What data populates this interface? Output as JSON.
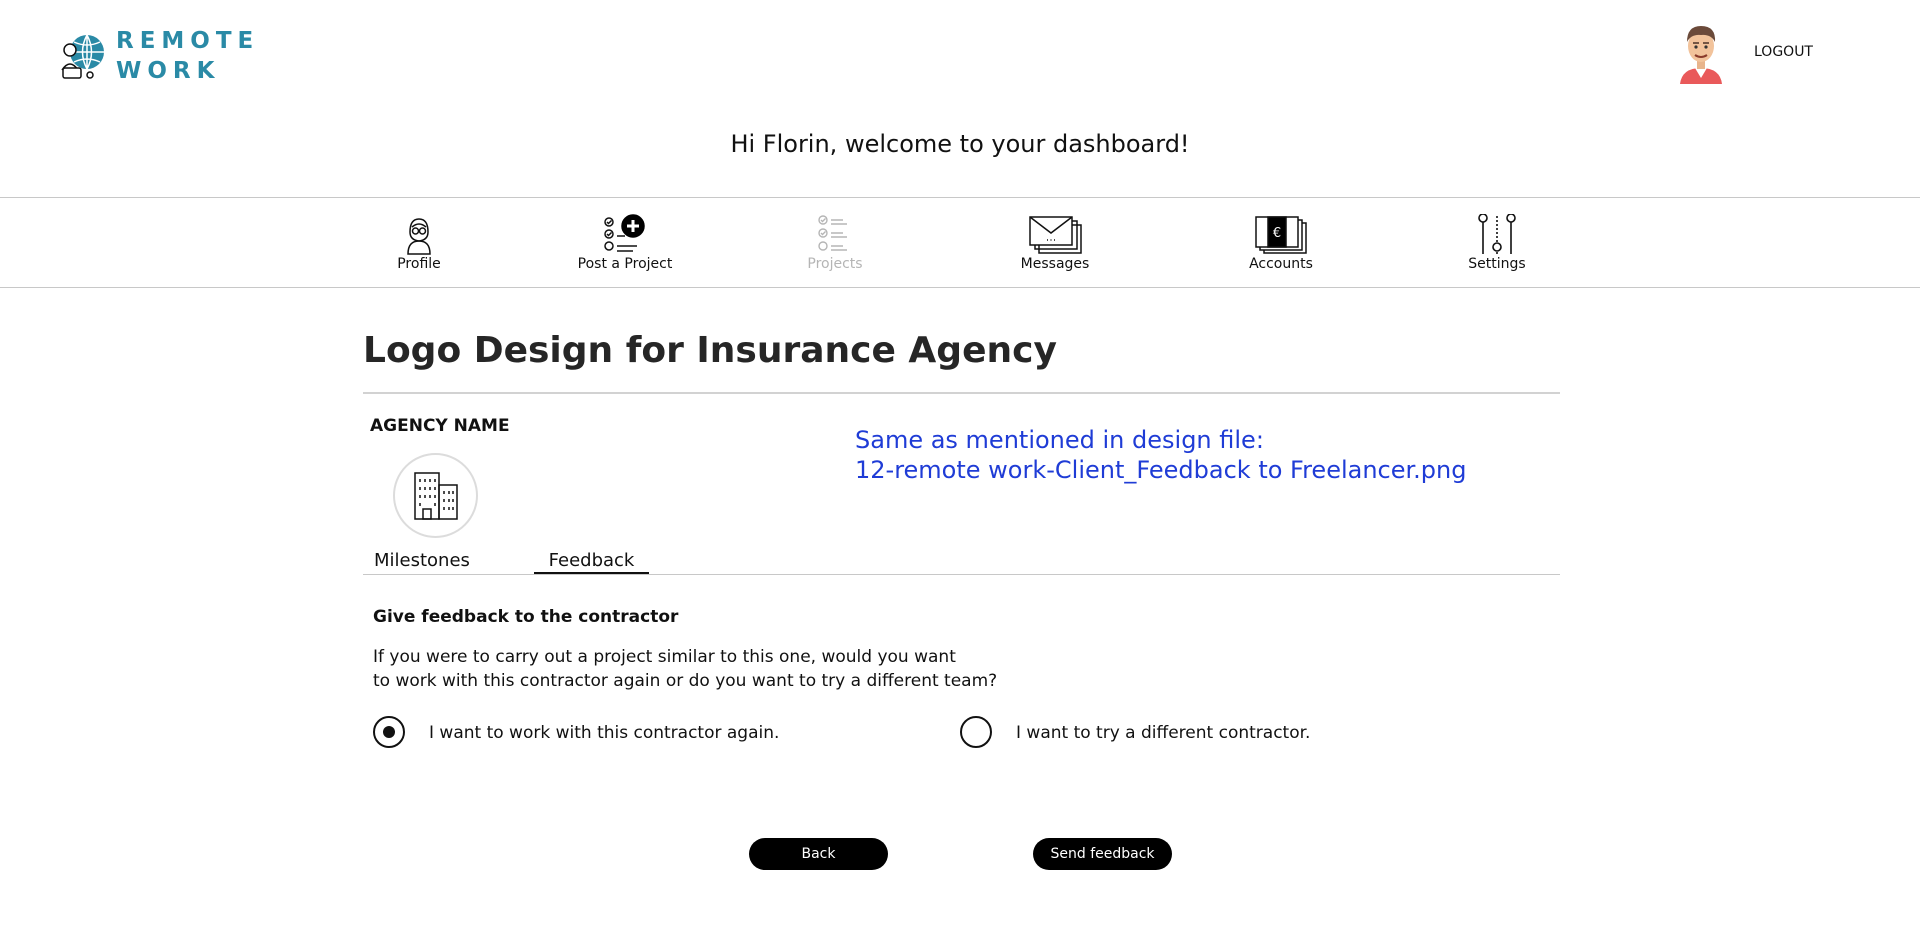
{
  "header": {
    "logo_line1": "REMOTE",
    "logo_line2": "WORK",
    "logout_label": "LOGOUT",
    "welcome": "Hi Florin, welcome to your dashboard!"
  },
  "nav": {
    "items": [
      {
        "label": "Profile",
        "icon": "profile-icon",
        "disabled": false
      },
      {
        "label": "Post a Project",
        "icon": "post-project-icon",
        "disabled": false
      },
      {
        "label": "Projects",
        "icon": "projects-checklist-icon",
        "disabled": true
      },
      {
        "label": "Messages",
        "icon": "envelope-icon",
        "disabled": false
      },
      {
        "label": "Accounts",
        "icon": "euro-bills-icon",
        "disabled": false
      },
      {
        "label": "Settings",
        "icon": "sliders-icon",
        "disabled": false
      }
    ]
  },
  "project": {
    "title": "Logo Design for Insurance Agency",
    "agency_label": "AGENCY NAME",
    "agency_icon": "building-icon",
    "note_line1": "Same as mentioned in design file:",
    "note_line2": "12-remote work-Client_Feedback to Freelancer.png"
  },
  "tabs": {
    "milestones": "Milestones",
    "feedback": "Feedback",
    "active": "Feedback"
  },
  "feedback": {
    "heading": "Give feedback to the contractor",
    "question_line1": "If you were to carry out a project similar to this one, would you want",
    "question_line2": "to work with this contractor again or do you want to try a different team?",
    "options": [
      {
        "label": "I want to work with this contractor again.",
        "selected": true
      },
      {
        "label": "I want to try a different contractor.",
        "selected": false
      }
    ]
  },
  "buttons": {
    "back": "Back",
    "send": "Send feedback"
  },
  "colors": {
    "brand": "#2a8aa6",
    "note": "#1f3cd6",
    "disabled": "#b5b5b5"
  }
}
